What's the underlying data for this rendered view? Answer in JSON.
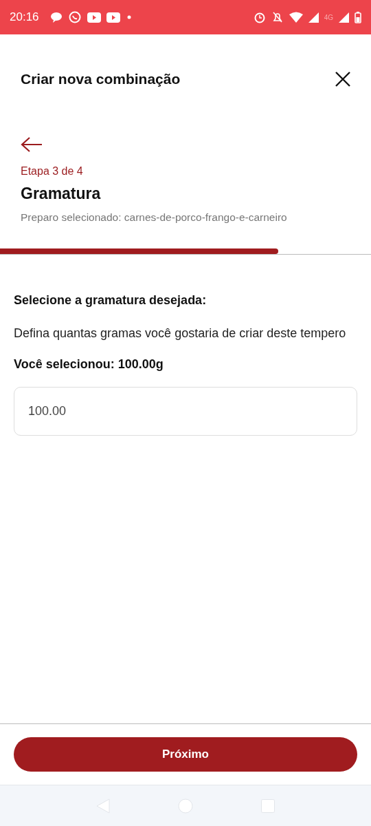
{
  "status_bar": {
    "time": "20:16",
    "network": "4G"
  },
  "header": {
    "title": "Criar nova combinação"
  },
  "step": {
    "label": "Etapa 3 de 4",
    "title": "Gramatura",
    "subtitle": "Preparo selecionado: carnes-de-porco-frango-e-carneiro"
  },
  "progress": {
    "level": 0.75
  },
  "content": {
    "heading": "Selecione a gramatura desejada:",
    "description": "Defina quantas gramas você gostaria de criar deste tempero",
    "selection": "Você selecionou: 100.00g",
    "field": {
      "value": "100.00"
    }
  },
  "footer": {
    "button": "Próximo"
  }
}
